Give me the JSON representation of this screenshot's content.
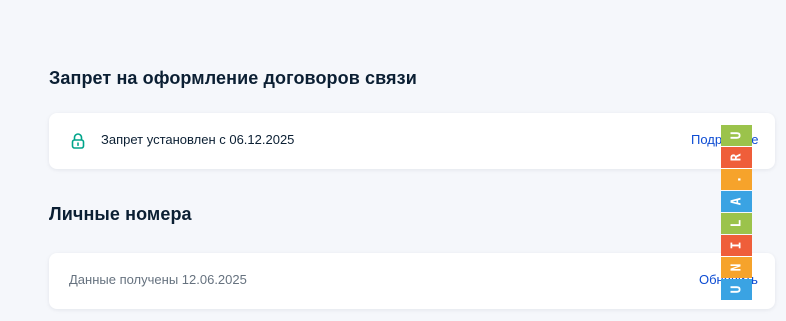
{
  "sections": {
    "ban": {
      "title": "Запрет на оформление договоров связи",
      "status_text": "Запрет установлен с 06.12.2025",
      "link_label": "Подробнее"
    },
    "numbers": {
      "title": "Личные номера",
      "status_text": "Данные получены 12.06.2025",
      "link_label": "Обновить"
    }
  },
  "icons": {
    "lock": "lock-icon"
  },
  "colors": {
    "background": "#f5f7fb",
    "card": "#ffffff",
    "link": "#0d4cd3",
    "lock_icon": "#00a48a",
    "muted_text": "#66727f"
  },
  "watermark": {
    "text": "UNILA.RU",
    "cells": [
      {
        "char": "U",
        "color": "#3aa3e3"
      },
      {
        "char": "N",
        "color": "#f6a32b"
      },
      {
        "char": "I",
        "color": "#ef5e3a"
      },
      {
        "char": "L",
        "color": "#9bc34b"
      },
      {
        "char": "A",
        "color": "#3aa3e3"
      },
      {
        "char": ".",
        "color": "#f6a32b"
      },
      {
        "char": "R",
        "color": "#ef5e3a"
      },
      {
        "char": "U",
        "color": "#9bc34b"
      }
    ]
  }
}
